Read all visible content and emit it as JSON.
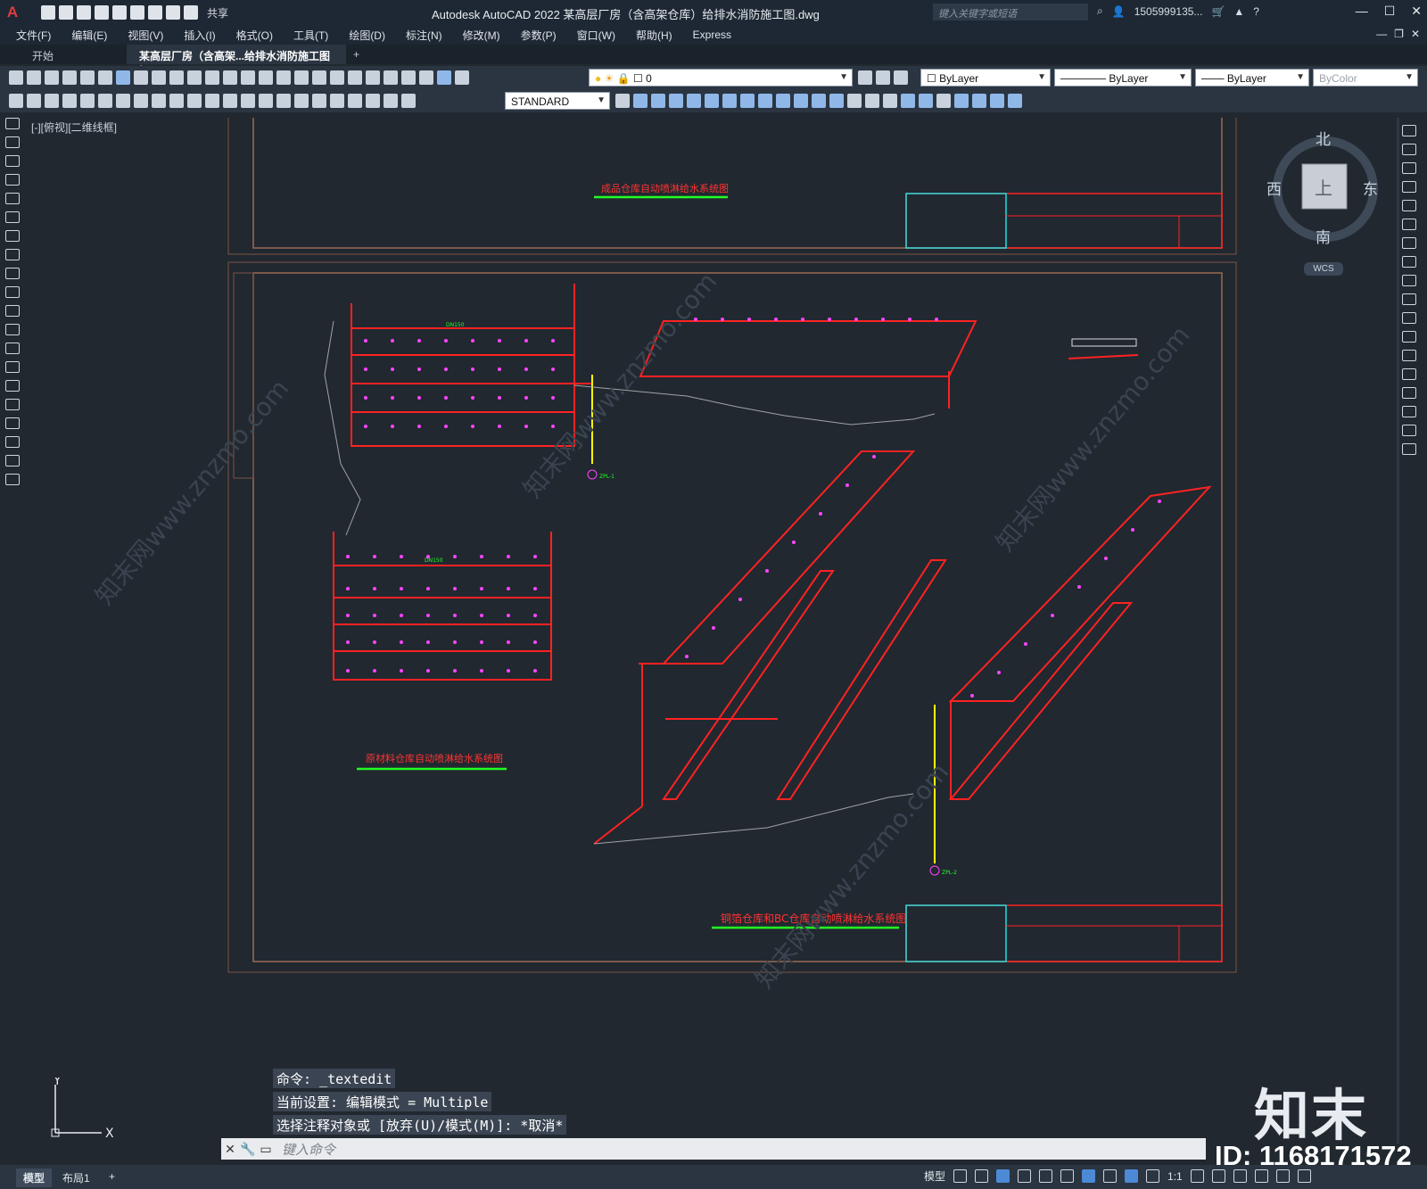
{
  "titlebar": {
    "app_letter": "A",
    "share": "共享",
    "title": "Autodesk AutoCAD 2022    某高层厂房（含高架仓库）给排水消防施工图.dwg",
    "search_placeholder": "键入关键字或短语",
    "user": "1505999135..."
  },
  "menu": [
    "文件(F)",
    "编辑(E)",
    "视图(V)",
    "插入(I)",
    "格式(O)",
    "工具(T)",
    "绘图(D)",
    "标注(N)",
    "修改(M)",
    "参数(P)",
    "窗口(W)",
    "帮助(H)",
    "Express"
  ],
  "tabs": {
    "start": "开始",
    "active": "某高层厂房（含高架...给排水消防施工图*",
    "close": "×",
    "new": "+"
  },
  "toolbar": {
    "layer": "0",
    "color": "ByLayer",
    "linetype": "ByLayer",
    "lineweight": "ByLayer",
    "plotstyle": "ByColor",
    "textstyle": "STANDARD"
  },
  "viewport": {
    "label": "[-][俯视][二维线框]"
  },
  "viewcube": {
    "north": "北",
    "south": "南",
    "east": "东",
    "west": "西",
    "face": "上",
    "wcs": "WCS"
  },
  "drawing": {
    "title_top": "成品仓库自动喷淋给水系统图",
    "title_mid": "原材料仓库自动喷淋给水系统图",
    "title_bot": "铜箔仓库和BC仓库自动喷淋给水系统图",
    "note_riser1": "ZPL-1",
    "note_riser2": "ZPL-2",
    "pipe_label": "DN150",
    "colors": {
      "pipe": "#ff2222",
      "riser": "#ffff00",
      "heads": "#ff44ff",
      "labels": "#22ff22",
      "frame": "#9a6a52",
      "titleblock": "#22dddd"
    }
  },
  "command": {
    "line1": "命令:  _textedit",
    "line2": "当前设置: 编辑模式 = Multiple",
    "line3": "选择注释对象或 [放弃(U)/模式(M)]: *取消*",
    "placeholder": "键入命令"
  },
  "layout_tabs": [
    "模型",
    "布局1",
    "+"
  ],
  "status": {
    "model": "模型",
    "scale": "1:1"
  },
  "watermark": {
    "logo": "知末",
    "id": "ID: 1168171572",
    "text": "知末网www.znzmo.com"
  },
  "ucs": {
    "y": "Y",
    "x": "X"
  }
}
